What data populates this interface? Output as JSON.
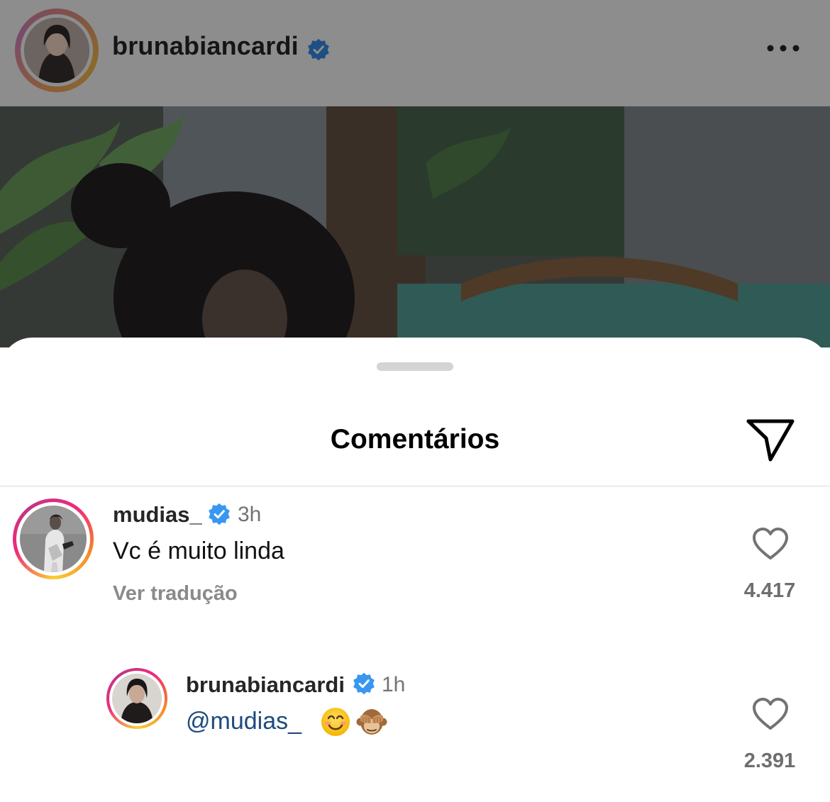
{
  "post": {
    "username": "brunabiancardi",
    "verified": true,
    "avatar_icon": "profile-photo",
    "more_icon": "more-horizontal-icon"
  },
  "comments_sheet": {
    "title": "Comentários",
    "share_icon": "paper-plane-icon",
    "comments": [
      {
        "username": "mudias_",
        "verified": true,
        "time": "3h",
        "text": "Vc é muito linda",
        "translate_label": "Ver tradução",
        "like_count": "4.417"
      },
      {
        "username": "brunabiancardi",
        "verified": true,
        "time": "1h",
        "mention": "@mudias_",
        "emojis": [
          "smiling-face-emoji",
          "see-no-evil-monkey-emoji"
        ],
        "like_count": "2.391"
      }
    ]
  },
  "colors": {
    "verified_blue": "#3897f0",
    "mention_blue": "#1e4b7e",
    "story_ring": [
      "#f9ce34",
      "#ee2a7b",
      "#c13584"
    ]
  }
}
